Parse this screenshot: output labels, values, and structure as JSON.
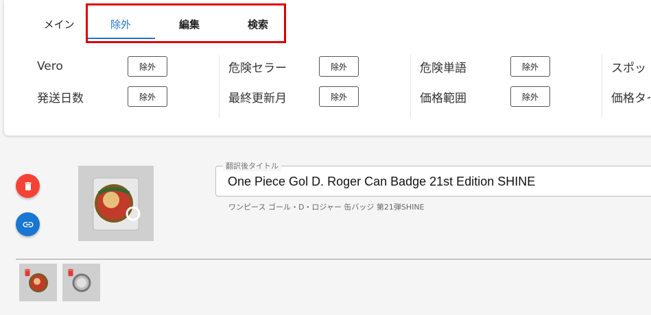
{
  "tabs": {
    "main_label": "メイン",
    "items": [
      {
        "label": "除外",
        "active": true
      },
      {
        "label": "編集",
        "active": false
      },
      {
        "label": "検索",
        "active": false
      }
    ]
  },
  "filters": {
    "button_label": "除外",
    "groups": [
      {
        "rows": [
          "Vero",
          "発送日数"
        ]
      },
      {
        "rows": [
          "危険セラー",
          "最終更新月"
        ]
      },
      {
        "rows": [
          "危険単語",
          "価格範囲"
        ]
      },
      {
        "rows": [
          "スポッ",
          "価格タイ"
        ]
      }
    ]
  },
  "item": {
    "field_label": "翻訳後タイトル",
    "title_value": "One Piece Gol D. Roger Can Badge 21st Edition SHINE",
    "original_title": "ワンピース ゴール・D・ロジャー 缶バッジ 第21弾SHINE",
    "delete_icon": "trash-icon",
    "link_icon": "link-icon"
  },
  "colors": {
    "accent": "#1976d2",
    "danger": "#f44336",
    "highlight": "#e00000"
  }
}
